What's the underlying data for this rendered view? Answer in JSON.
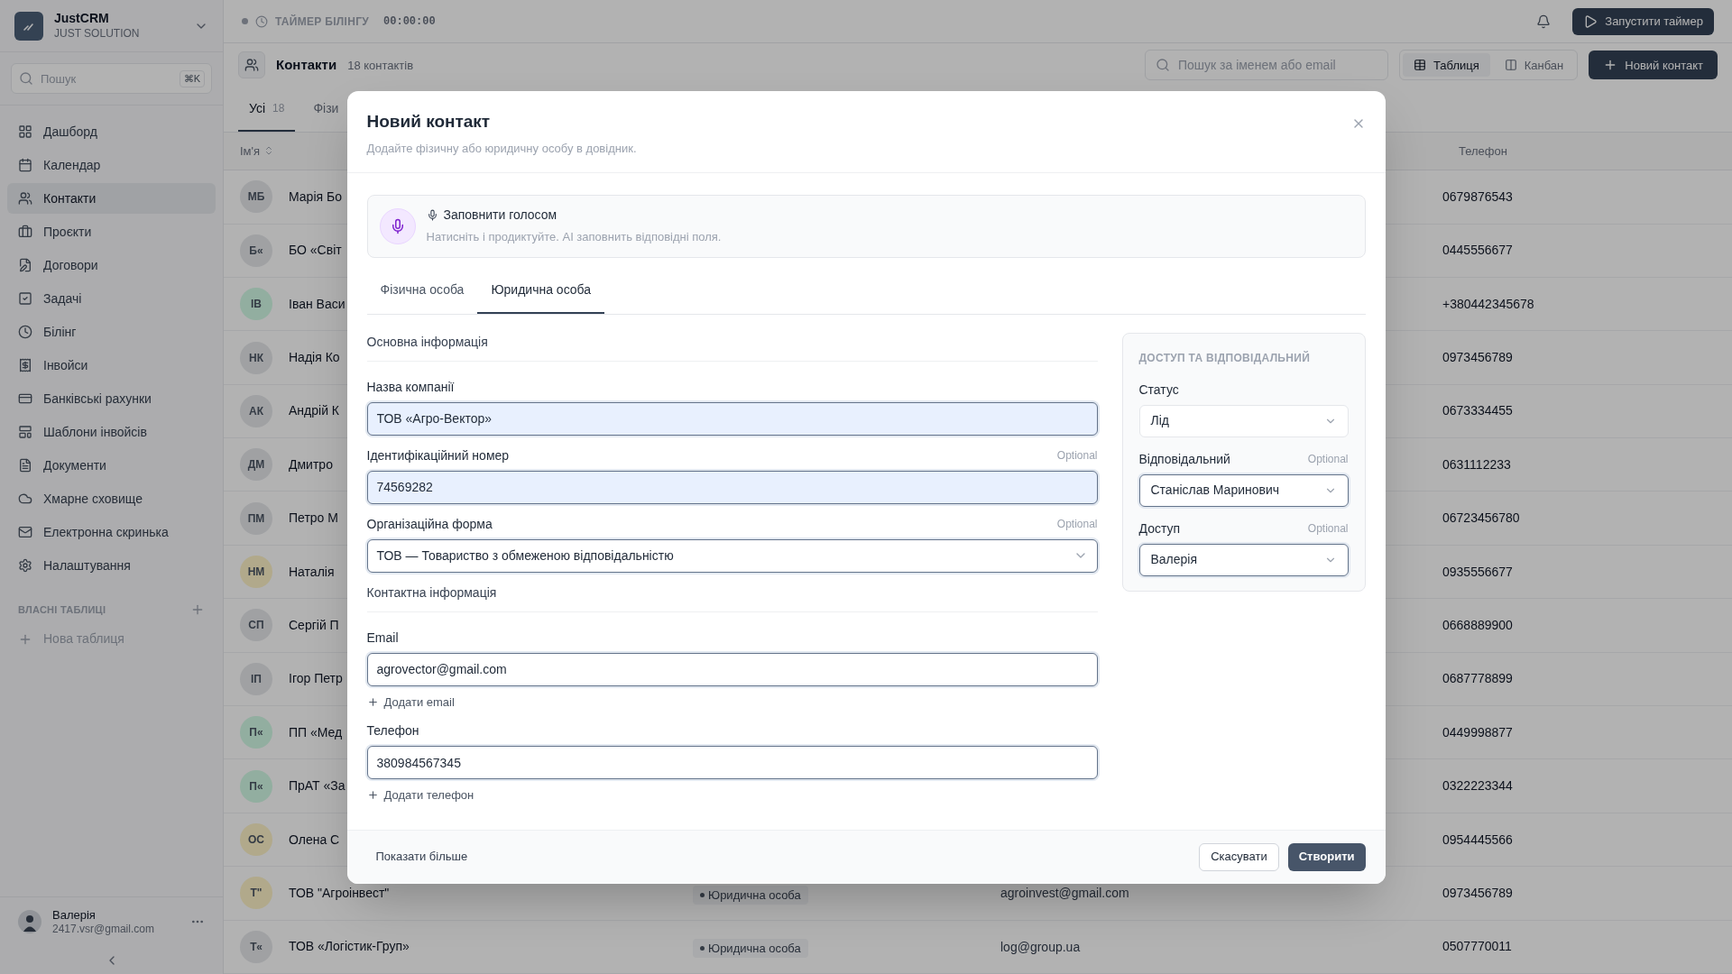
{
  "sidebar": {
    "brand": {
      "name": "JustCRM",
      "subtitle": "JUST SOLUTION"
    },
    "search": {
      "placeholder": "Пошук",
      "shortcut": "⌘K"
    },
    "items": [
      {
        "label": "Дашборд",
        "selected": false
      },
      {
        "label": "Календар",
        "selected": false
      },
      {
        "label": "Контакти",
        "selected": true
      },
      {
        "label": "Проєкти",
        "selected": false
      },
      {
        "label": "Договори",
        "selected": false
      },
      {
        "label": "Задачі",
        "selected": false
      },
      {
        "label": "Білінг",
        "selected": false
      },
      {
        "label": "Інвойси",
        "selected": false
      },
      {
        "label": "Банківські рахунки",
        "selected": false
      },
      {
        "label": "Шаблони інвойсів",
        "selected": false
      },
      {
        "label": "Документи",
        "selected": false
      },
      {
        "label": "Хмарне сховище",
        "selected": false
      },
      {
        "label": "Електронна скринька",
        "selected": false
      },
      {
        "label": "Налаштування",
        "selected": false
      }
    ],
    "section": {
      "title": "ВЛАСНІ ТАБЛИЦІ",
      "items": [
        "Нова таблиця"
      ]
    },
    "user": {
      "name": "Валерія",
      "email": "2417.vsr@gmail.com"
    }
  },
  "top_bar": {
    "timer_label": "ТАЙМЕР БІЛІНГУ",
    "timer": "00:00:00",
    "start_button": "Запустити таймер"
  },
  "page_header": {
    "title": "Контакти",
    "count": "18 контактів",
    "search_placeholder": "Пошук за іменем або email",
    "views": [
      {
        "label": "Таблиця",
        "selected": true
      },
      {
        "label": "Канбан",
        "selected": false
      }
    ],
    "new_button": "Новий контакт"
  },
  "filter_tabs": [
    {
      "label": "Усі",
      "count": "18",
      "selected": true
    },
    {
      "label": "Фізи",
      "selected": false
    }
  ],
  "table": {
    "columns": [
      "Ім'я",
      "Телефон"
    ],
    "rows": [
      {
        "initials": "МБ",
        "color": "#a0a2a4",
        "name": "Марія Бо",
        "phone": "0679876543"
      },
      {
        "initials": "Б«",
        "color": "#a0a2a4",
        "name": "БО «Світ",
        "phone": "0445556677"
      },
      {
        "initials": "ІВ",
        "color": "#92afa0",
        "name": "Іван Васи",
        "phone": "+380442345678"
      },
      {
        "initials": "НК",
        "color": "#a0a2a4",
        "name": "Надія Ко",
        "phone": "0973456789"
      },
      {
        "initials": "АК",
        "color": "#a0a2a4",
        "name": "Андрій К",
        "phone": "0673334455"
      },
      {
        "initials": "ДМ",
        "color": "#a0a2a4",
        "name": "Дмитро",
        "phone": "0631112233"
      },
      {
        "initials": "ПМ",
        "color": "#a0a2a4",
        "name": "Петро М",
        "phone": "06723456780"
      },
      {
        "initials": "НМ",
        "color": "#b2aa8b",
        "name": "Наталія",
        "phone": "0935556677"
      },
      {
        "initials": "СП",
        "color": "#a0a2a4",
        "name": "Сергій П",
        "phone": "0668889900"
      },
      {
        "initials": "ІП",
        "color": "#a0a2a4",
        "name": "Ігор Петр",
        "phone": "0687778899"
      },
      {
        "initials": "П«",
        "color": "#92afa0",
        "name": "ПП «Мед",
        "phone": "0449998877"
      },
      {
        "initials": "П«",
        "color": "#92afa0",
        "name": "ПрАТ «За",
        "phone": "0322223344"
      },
      {
        "initials": "ОС",
        "color": "#b2aa8b",
        "name": "Олена С",
        "phone": "0954445566"
      },
      {
        "initials": "Т\"",
        "color": "#b2aa8b",
        "name": "ТОВ \"Агроінвест\"",
        "type": "Юридична особа",
        "email": "agroinvest@gmail.com",
        "phone": "0973456789"
      },
      {
        "initials": "Т«",
        "color": "#a0a2a4",
        "name": "ТОВ «Логістик-Груп»",
        "type": "Юридична особа",
        "email": "log@group.ua",
        "phone": "0507770011"
      }
    ]
  },
  "modal": {
    "title": "Новий контакт",
    "subtitle": "Додайте фізичну або юридичну особу в довідник.",
    "voice": {
      "title": "Заповнити голосом",
      "hint": "Натисніть і продиктуйте. AI заповнить відповідні поля."
    },
    "tabs": [
      {
        "label": "Фізична особа",
        "selected": false
      },
      {
        "label": "Юридична особа",
        "selected": true
      }
    ],
    "sections": [
      {
        "title": "Основна інформація",
        "fields": [
          {
            "kind": "input",
            "label": "Назва компанії",
            "value": "ТОВ «Агро-Вектор»",
            "autofilled": true
          },
          {
            "kind": "input",
            "label": "Ідентифікаційний номер",
            "optional": "Optional",
            "value": "74569282",
            "autofilled": true
          },
          {
            "kind": "select",
            "label": "Організаційна форма",
            "optional": "Optional",
            "value": "ТОВ — Товариство з обмеженою відповідальністю",
            "autofilled": false
          }
        ]
      },
      {
        "title": "Контактна інформація",
        "fields": [
          {
            "kind": "input",
            "label": "Email",
            "value": "agrovector@gmail.com",
            "autofilled": false,
            "add": "Додати email"
          },
          {
            "kind": "input",
            "label": "Телефон",
            "value": "380984567345",
            "autofilled": false,
            "add": "Додати телефон"
          }
        ]
      }
    ],
    "side_panel": {
      "title": "ДОСТУП ТА ВІДПОВІДАЛЬНИЙ",
      "fields": [
        {
          "label": "Статус",
          "value": "Лід",
          "focused": false
        },
        {
          "label": "Відповідальний",
          "optional": "Optional",
          "value": "Станіслав Маринович",
          "focused": true
        },
        {
          "label": "Доступ",
          "optional": "Optional",
          "value": "Валерія",
          "focused": true
        }
      ]
    },
    "footer": {
      "more": "Показати більше",
      "cancel": "Скасувати",
      "submit": "Створити"
    }
  }
}
